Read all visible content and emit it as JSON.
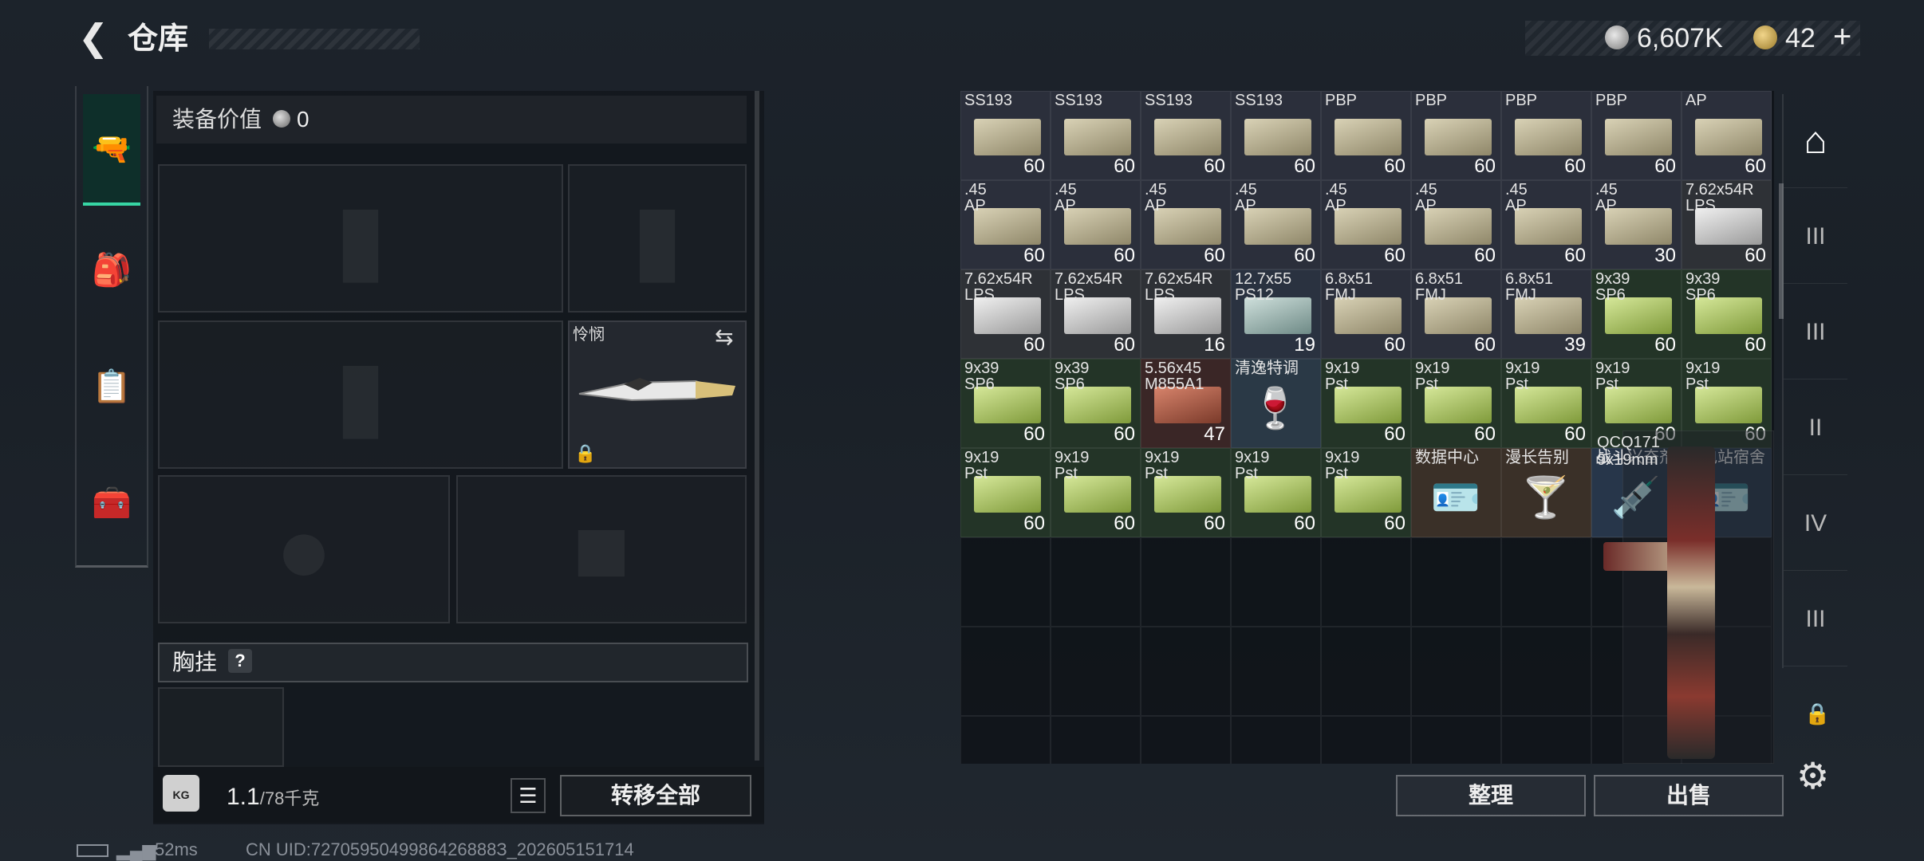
{
  "header": {
    "back_icon": "chevron-left-icon",
    "title": "仓库"
  },
  "currency": {
    "coin_value": "6,607K",
    "premium_value": "42",
    "plus_label": "+"
  },
  "left_rail": [
    {
      "icon": "pistol-icon",
      "label": "🔫",
      "selected": true
    },
    {
      "icon": "backpack-icon",
      "label": "🎒"
    },
    {
      "icon": "clipboard-icon",
      "label": "📋"
    },
    {
      "icon": "toolbox-icon",
      "label": "🧰"
    }
  ],
  "equipment": {
    "value_label": "装备价值",
    "value": "0",
    "melee_name": "怜悯",
    "chest_rig_label": "胸挂",
    "help_label": "?"
  },
  "weight": {
    "current": "1.1",
    "max": "/78千克",
    "icon_text": "KG"
  },
  "buttons": {
    "transfer_all": "转移全部",
    "sort": "整理",
    "sell": "出售",
    "list_icon": "☰"
  },
  "status": {
    "ping": "52ms",
    "uid": "CN UID:7270595049986426888З_202605151714"
  },
  "grid_items": [
    {
      "name": "SS193",
      "count": "60",
      "kind": "a",
      "box": "tan"
    },
    {
      "name": "SS193",
      "count": "60",
      "kind": "a",
      "box": "tan"
    },
    {
      "name": "SS193",
      "count": "60",
      "kind": "a",
      "box": "tan"
    },
    {
      "name": "SS193",
      "count": "60",
      "kind": "a",
      "box": "tan"
    },
    {
      "name": "PBP",
      "count": "60",
      "kind": "a",
      "box": "tan"
    },
    {
      "name": "PBP",
      "count": "60",
      "kind": "a",
      "box": "tan"
    },
    {
      "name": "PBP",
      "count": "60",
      "kind": "a",
      "box": "tan"
    },
    {
      "name": "PBP",
      "count": "60",
      "kind": "a",
      "box": "tan"
    },
    {
      "name": "AP",
      "count": "60",
      "kind": "a",
      "box": "tan"
    },
    {
      "name": ".45\nAP",
      "count": "60",
      "kind": "a",
      "box": "tan"
    },
    {
      "name": ".45\nAP",
      "count": "60",
      "kind": "a",
      "box": "tan"
    },
    {
      "name": ".45\nAP",
      "count": "60",
      "kind": "a",
      "box": "tan"
    },
    {
      "name": ".45\nAP",
      "count": "60",
      "kind": "a",
      "box": "tan"
    },
    {
      "name": ".45\nAP",
      "count": "60",
      "kind": "a",
      "box": "tan"
    },
    {
      "name": ".45\nAP",
      "count": "60",
      "kind": "a",
      "box": "tan"
    },
    {
      "name": ".45\nAP",
      "count": "60",
      "kind": "a",
      "box": "tan"
    },
    {
      "name": ".45\nAP",
      "count": "30",
      "kind": "a",
      "box": "tan"
    },
    {
      "name": "7.62x54R\nLPS",
      "count": "60",
      "kind": "w",
      "box": "white"
    },
    {
      "name": "7.62x54R\nLPS",
      "count": "60",
      "kind": "w",
      "box": "white"
    },
    {
      "name": "7.62x54R\nLPS",
      "count": "60",
      "kind": "w",
      "box": "white"
    },
    {
      "name": "7.62x54R\nLPS",
      "count": "16",
      "kind": "w",
      "box": "white"
    },
    {
      "name": "12.7x55\nPS12",
      "count": "19",
      "kind": "b",
      "box": "teal"
    },
    {
      "name": "6.8x51\nFMJ",
      "count": "60",
      "kind": "a",
      "box": "tan"
    },
    {
      "name": "6.8x51\nFMJ",
      "count": "60",
      "kind": "a",
      "box": "tan"
    },
    {
      "name": "6.8x51\nFMJ",
      "count": "39",
      "kind": "a",
      "box": "tan"
    },
    {
      "name": "9x39\nSP6",
      "count": "60",
      "kind": "g",
      "box": "green"
    },
    {
      "name": "9x39\nSP6",
      "count": "60",
      "kind": "g",
      "box": "green"
    },
    {
      "name": "9x39\nSP6",
      "count": "60",
      "kind": "g",
      "box": "green"
    },
    {
      "name": "9x39\nSP6",
      "count": "60",
      "kind": "g",
      "box": "green"
    },
    {
      "name": "5.56x45\nM855A1",
      "count": "47",
      "kind": "r",
      "box": "red"
    },
    {
      "name": "清逸特调",
      "count": "",
      "kind": "teal",
      "glyph": "🍷"
    },
    {
      "name": "9x19\nPst",
      "count": "60",
      "kind": "g",
      "box": "green"
    },
    {
      "name": "9x19\nPst",
      "count": "60",
      "kind": "g",
      "box": "green"
    },
    {
      "name": "9x19\nPst",
      "count": "60",
      "kind": "g",
      "box": "green"
    },
    {
      "name": "9x19\nPst",
      "count": "60",
      "kind": "g",
      "box": "green"
    },
    {
      "name": "9x19\nPst",
      "count": "60",
      "kind": "g",
      "box": "green"
    },
    {
      "name": "9x19\nPst",
      "count": "60",
      "kind": "g",
      "box": "green"
    },
    {
      "name": "9x19\nPst",
      "count": "60",
      "kind": "g",
      "box": "green"
    },
    {
      "name": "9x19\nPst",
      "count": "60",
      "kind": "g",
      "box": "green"
    },
    {
      "name": "9x19\nPst",
      "count": "60",
      "kind": "g",
      "box": "green"
    },
    {
      "name": "9x19\nPst",
      "count": "60",
      "kind": "g",
      "box": "green"
    },
    {
      "name": "数据中心",
      "count": "",
      "kind": "brown",
      "glyph": "🪪"
    },
    {
      "name": "漫长告别",
      "count": "",
      "kind": "brown",
      "glyph": "🍸"
    },
    {
      "name": "战斗兴奋剂",
      "count": "",
      "kind": "blue",
      "glyph": "💉"
    },
    {
      "name": "变电站宿舍",
      "count": "",
      "kind": "blue",
      "glyph": "🪪"
    }
  ],
  "big_item": {
    "name": "QCQ171\n9x19mm"
  },
  "right_rail": [
    {
      "icon": "warehouse-icon",
      "label": "⌂"
    },
    {
      "icon": "storage-tier-3-icon",
      "label": "III"
    },
    {
      "icon": "storage-tier-3b-icon",
      "label": "III"
    },
    {
      "icon": "storage-tier-2-icon",
      "label": "II"
    },
    {
      "icon": "storage-tier-4-icon",
      "label": "IV"
    },
    {
      "icon": "storage-tier-3c-icon",
      "label": "III"
    }
  ],
  "colors": {
    "accent": "#37d6a4",
    "panel": "#12161b"
  }
}
